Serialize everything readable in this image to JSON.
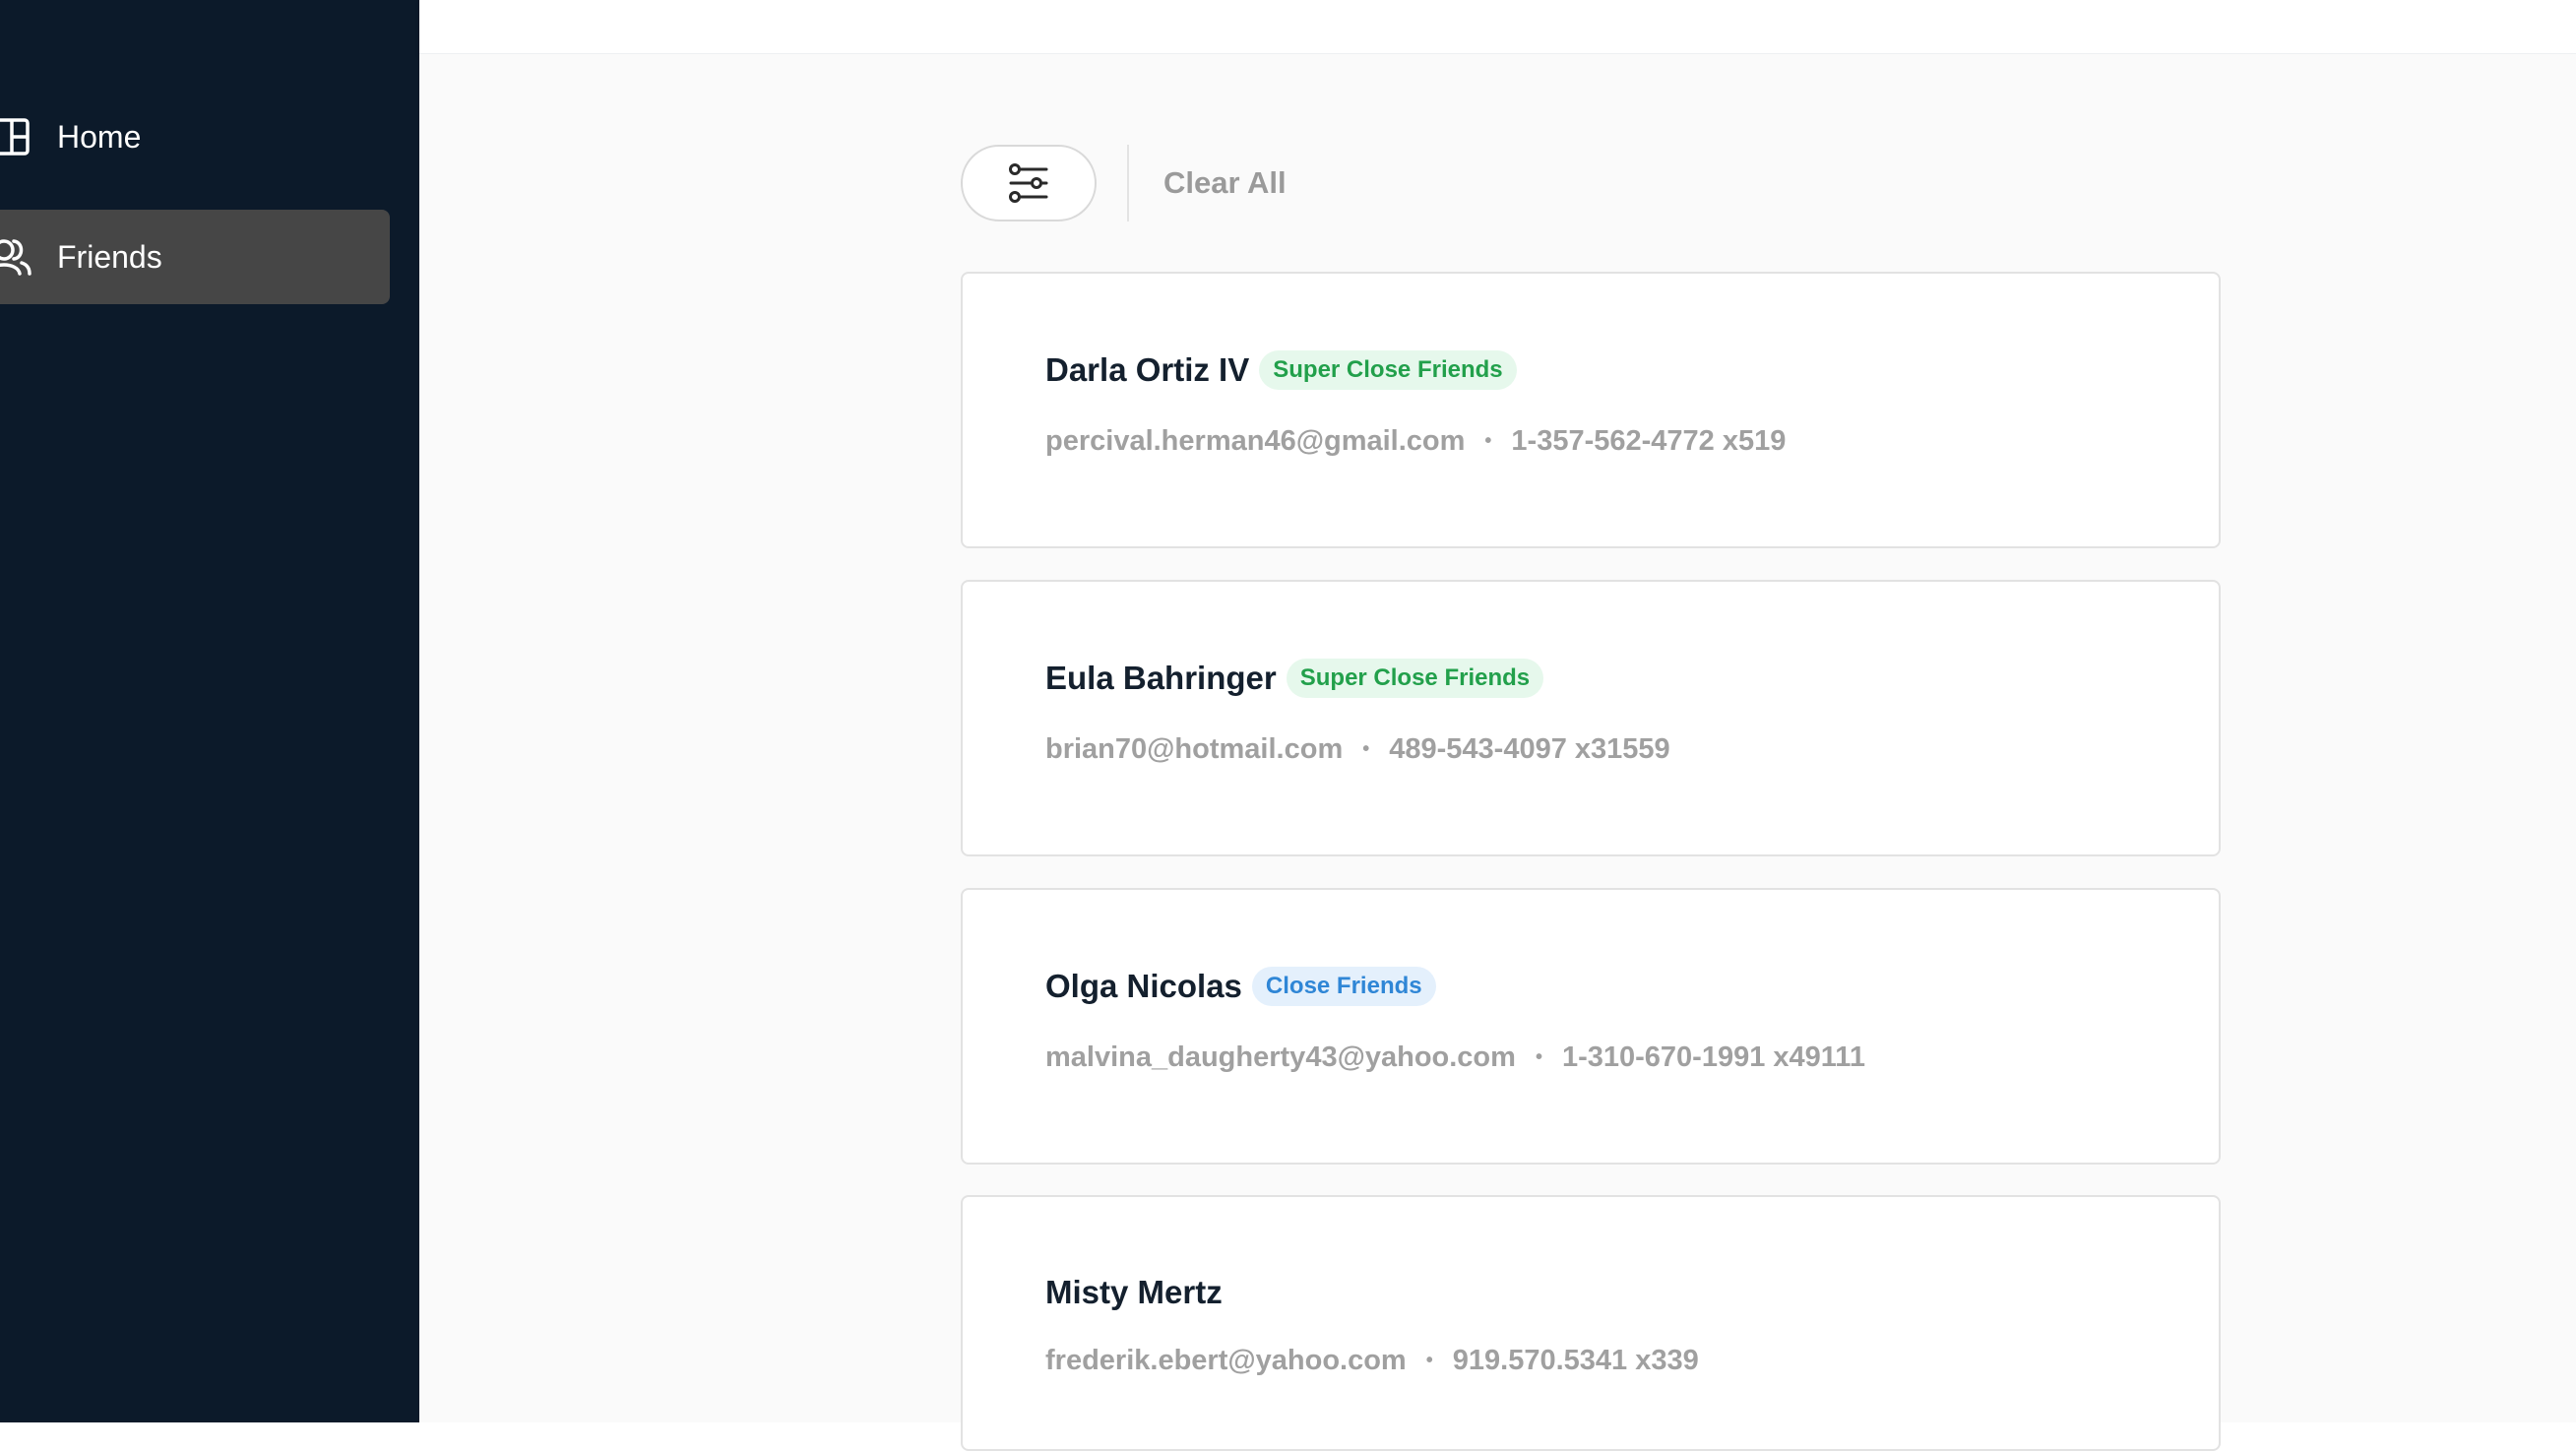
{
  "sidebar": {
    "items": [
      {
        "label": "Home",
        "icon": "layout-icon",
        "active": false
      },
      {
        "label": "Friends",
        "icon": "users-icon",
        "active": true
      }
    ]
  },
  "toolbar": {
    "filter_icon": "sliders-icon",
    "clear_all_label": "Clear All"
  },
  "colors": {
    "sidebar_bg": "#0c1a2a",
    "active_nav_bg": "#464646",
    "super_badge_text": "#22a04b",
    "super_badge_bg": "#e6f8ec",
    "close_badge_text": "#2f86d6",
    "close_badge_bg": "#e4f0fc"
  },
  "friends": [
    {
      "name": "Darla Ortiz IV",
      "badge": "Super Close Friends",
      "email": "percival.herman46@gmail.com",
      "separator": "•",
      "phone": "1-357-562-4772 x519"
    },
    {
      "name": "Eula Bahringer",
      "badge": "Super Close Friends",
      "email": "brian70@hotmail.com",
      "separator": "•",
      "phone": "489-543-4097 x31559"
    },
    {
      "name": "Olga Nicolas",
      "badge": "Close Friends",
      "email": "malvina_daugherty43@yahoo.com",
      "separator": "•",
      "phone": "1-310-670-1991 x49111"
    },
    {
      "name": "Misty Mertz",
      "badge": "",
      "email": "frederik.ebert@yahoo.com",
      "separator": "•",
      "phone": "919.570.5341 x339"
    }
  ]
}
